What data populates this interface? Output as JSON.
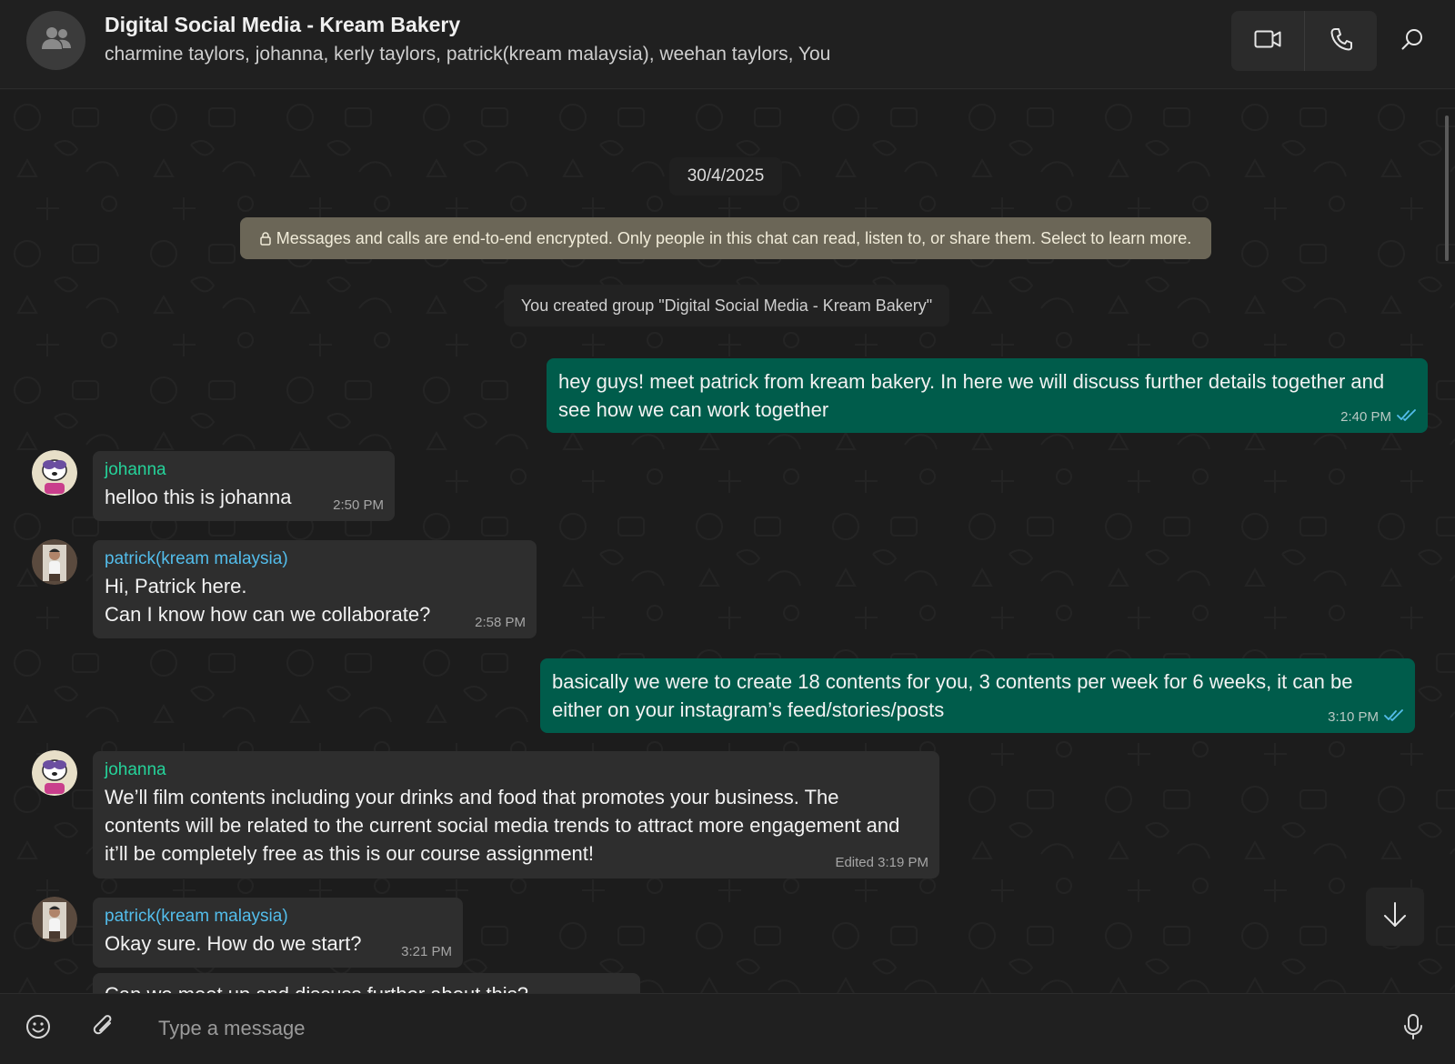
{
  "header": {
    "title": "Digital Social Media - Kream Bakery",
    "members": "charmine taylors, johanna, kerly taylors, patrick(kream malaysia), weehan taylors, You",
    "icons": [
      "group-icon",
      "video-call-icon",
      "voice-call-icon",
      "search-icon"
    ]
  },
  "chat": {
    "date": "30/4/2025",
    "encryption_notice": "Messages and calls are end-to-end encrypted. Only people in this chat can read, listen to, or share them. Select to learn more.",
    "system_message": "You created group \"Digital Social Media - Kream Bakery\"",
    "messages": [
      {
        "direction": "out",
        "text": "hey guys! meet patrick from kream bakery. In here we will discuss further details together and see how we can work together",
        "time": "2:40 PM",
        "status": "read"
      },
      {
        "direction": "in",
        "sender": "johanna",
        "text": "helloo this is johanna",
        "time": "2:50 PM"
      },
      {
        "direction": "in",
        "sender": "patrick(kream malaysia)",
        "text_lines": [
          "Hi, Patrick here.",
          "Can I know how can we collaborate?"
        ],
        "time": "2:58 PM"
      },
      {
        "direction": "out",
        "text": "basically we were to create 18 contents for you, 3 contents per week for 6 weeks, it can be either on your instagram’s feed/stories/posts",
        "time": "3:10 PM",
        "status": "read"
      },
      {
        "direction": "in",
        "sender": "johanna",
        "text": "We’ll film contents including your drinks and food that promotes your business. The contents will be related to the current social media trends to attract more engagement and it’ll be completely free as this is our course assignment!",
        "time": "Edited 3:19 PM"
      },
      {
        "direction": "in",
        "sender": "patrick(kream malaysia)",
        "text": "Okay sure. How do we start?",
        "time": "3:21 PM"
      },
      {
        "direction": "in",
        "text": "Can we meet up and discuss further about this?",
        "partial": true
      }
    ]
  },
  "composer": {
    "placeholder": "Type a message",
    "icons": [
      "emoji-icon",
      "attach-icon",
      "microphone-icon"
    ]
  },
  "colors": {
    "outgoing_bubble": "#005c4b",
    "incoming_bubble": "#2e2e2e",
    "sender_johanna": "#25d39a",
    "sender_patrick": "#53bdeb",
    "read_ticks": "#53bdeb",
    "encryption_notice_bg": "#6b6657"
  }
}
